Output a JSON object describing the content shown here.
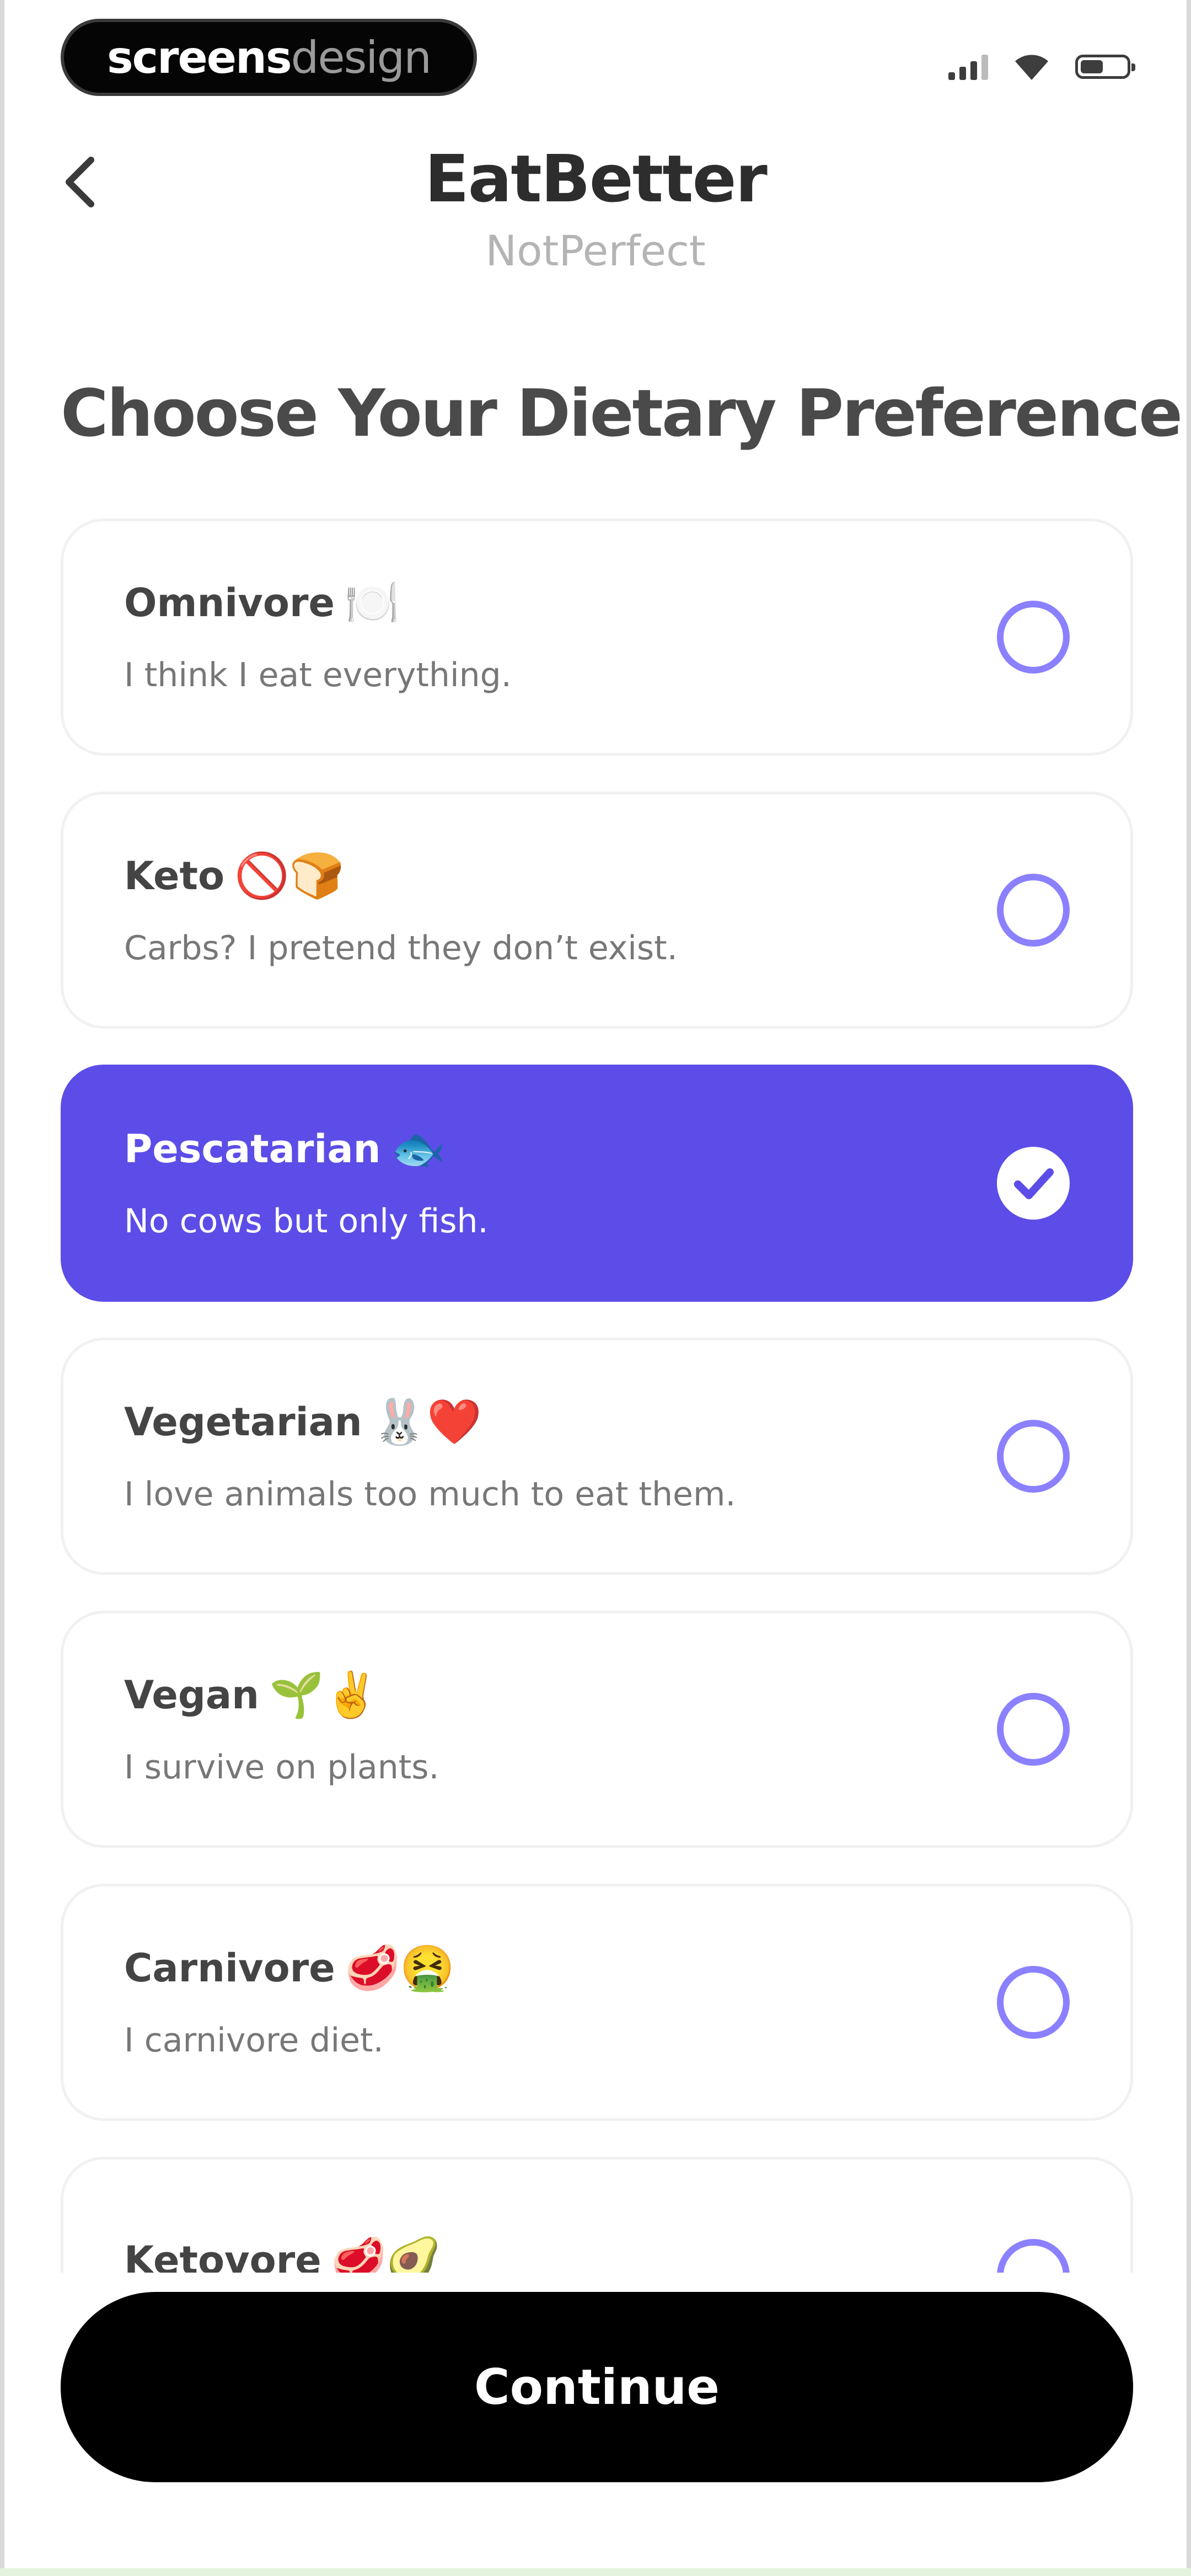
{
  "badge": {
    "part1": "screens",
    "part2": "design"
  },
  "header": {
    "title": "EatBetter",
    "subtitle": "NotPerfect"
  },
  "heading": "Choose Your Dietary Preference",
  "options": [
    {
      "title": "Omnivore",
      "emoji": "🍽️",
      "desc": "I think I eat everything.",
      "selected": false
    },
    {
      "title": "Keto",
      "emoji": "🚫🍞",
      "desc": "Carbs? I pretend they don’t exist.",
      "selected": false
    },
    {
      "title": "Pescatarian",
      "emoji": "🐟",
      "desc": "No cows but only fish.",
      "selected": true
    },
    {
      "title": "Vegetarian",
      "emoji": "🐰❤️",
      "desc": "I love animals too much to eat them.",
      "selected": false
    },
    {
      "title": "Vegan",
      "emoji": "🌱✌️",
      "desc": "I survive on plants.",
      "selected": false
    },
    {
      "title": "Carnivore",
      "emoji": "🥩🤮",
      "desc": "I carnivore diet.",
      "selected": false
    },
    {
      "title": "Ketovore",
      "emoji": "🥩🥑",
      "desc": "",
      "selected": false
    }
  ],
  "cta": {
    "label": "Continue"
  },
  "colors": {
    "accent": "#5c4de8",
    "radio": "#8b80ff",
    "button": "#000000"
  },
  "icons": {
    "back": "chevron-left-icon",
    "check": "check-icon",
    "signal": "signal-icon",
    "wifi": "wifi-icon",
    "battery": "battery-icon"
  }
}
